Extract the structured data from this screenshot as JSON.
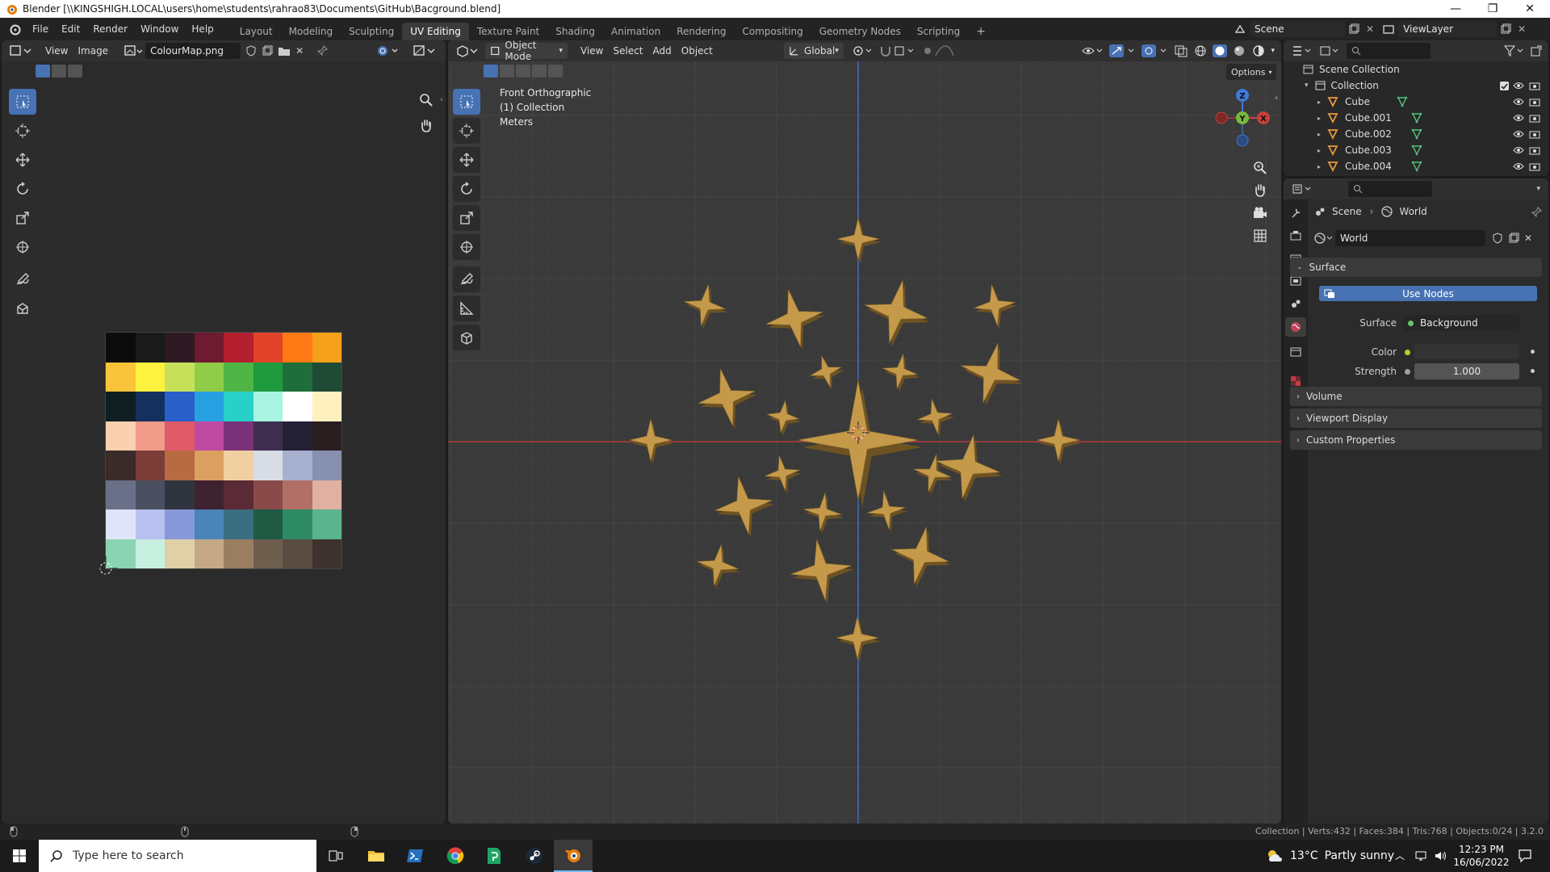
{
  "window": {
    "title": "Blender [\\\\KINGSHIGH.LOCAL\\users\\home\\students\\rahrao83\\Documents\\GitHub\\Bacground.blend]"
  },
  "menu": [
    "File",
    "Edit",
    "Render",
    "Window",
    "Help"
  ],
  "workspaces": [
    "Layout",
    "Modeling",
    "Sculpting",
    "UV Editing",
    "Texture Paint",
    "Shading",
    "Animation",
    "Rendering",
    "Compositing",
    "Geometry Nodes",
    "Scripting"
  ],
  "active_workspace": "UV Editing",
  "scene_field": "Scene",
  "viewlayer_field": "ViewLayer",
  "image_editor": {
    "menus": [
      "View",
      "Image"
    ],
    "image_name": "ColourMap.png",
    "palette": [
      [
        "#0c0c0c",
        "#1a1a1a",
        "#2e1a22",
        "#6e1a30",
        "#b5202e",
        "#e2442a",
        "#ff7a14",
        "#f5a11c"
      ],
      [
        "#f9c43a",
        "#fdf23e",
        "#c7e05a",
        "#8fcc48",
        "#4fb544",
        "#1f9a3e",
        "#1e6e3c",
        "#1e4a36"
      ],
      [
        "#0f1e20",
        "#14305c",
        "#2a5ec8",
        "#26a0e0",
        "#28d0c8",
        "#a8f4e0",
        "#ffffff",
        "#fff0c0"
      ],
      [
        "#f9d0b0",
        "#f09a8a",
        "#e05a6a",
        "#c04aa0",
        "#7a3278",
        "#3e2e50",
        "#242036",
        "#2a1e1e"
      ],
      [
        "#3a2a2a",
        "#7a3e36",
        "#b86a42",
        "#dca060",
        "#f0d0a0",
        "#d8dce4",
        "#a8b0d0",
        "#8890b0"
      ],
      [
        "#6a7088",
        "#4a5060",
        "#30343e",
        "#3e2230",
        "#5a2a36",
        "#8a4a4a",
        "#b07066",
        "#e0b0a0"
      ],
      [
        "#e0e4f8",
        "#b8c0f0",
        "#8898d8",
        "#4a84b8",
        "#3a6e80",
        "#1e5a44",
        "#2e8a64",
        "#5ab48e"
      ],
      [
        "#8ad4b4",
        "#c8f0e0",
        "#e0d0a8",
        "#c4a888",
        "#9a7e60",
        "#6e5e4e",
        "#5a4c40",
        "#3e322e"
      ]
    ]
  },
  "viewport": {
    "mode": "Object Mode",
    "menus": [
      "View",
      "Select",
      "Add",
      "Object"
    ],
    "orientation": "Global",
    "options_label": "Options",
    "overlay": [
      "Front Orthographic",
      "(1) Collection",
      "Meters"
    ],
    "gizmo_labels": {
      "z": "Z",
      "y": "Y",
      "x": "X"
    }
  },
  "outliner": {
    "scene_collection": "Scene Collection",
    "collection": "Collection",
    "objects": [
      "Cube",
      "Cube.001",
      "Cube.002",
      "Cube.003",
      "Cube.004"
    ]
  },
  "properties": {
    "breadcrumb": [
      "Scene",
      "World"
    ],
    "world_name": "World",
    "surface_section": "Surface",
    "use_nodes_label": "Use Nodes",
    "surface_label": "Surface",
    "surface_value": "Background",
    "color_label": "Color",
    "color_swatch": "#333333",
    "strength_label": "Strength",
    "strength_value": "1.000",
    "sections": [
      "Volume",
      "Viewport Display",
      "Custom Properties"
    ]
  },
  "status": {
    "text": "Collection | Verts:432 | Faces:384 | Tris:768 | Objects:0/24 | 3.2.0"
  },
  "taskbar": {
    "search_placeholder": "Type here to search",
    "weather_temp": "13°C",
    "weather_desc": "Partly sunny",
    "time": "12:23 PM",
    "date": "16/06/2022"
  },
  "colors": {
    "accent": "#4772b3",
    "star": "#c49a4a",
    "star_side": "#6e5222",
    "x_axis": "#c8403c",
    "y_axis": "#7ab83c",
    "z_axis": "#3d7ad8"
  }
}
